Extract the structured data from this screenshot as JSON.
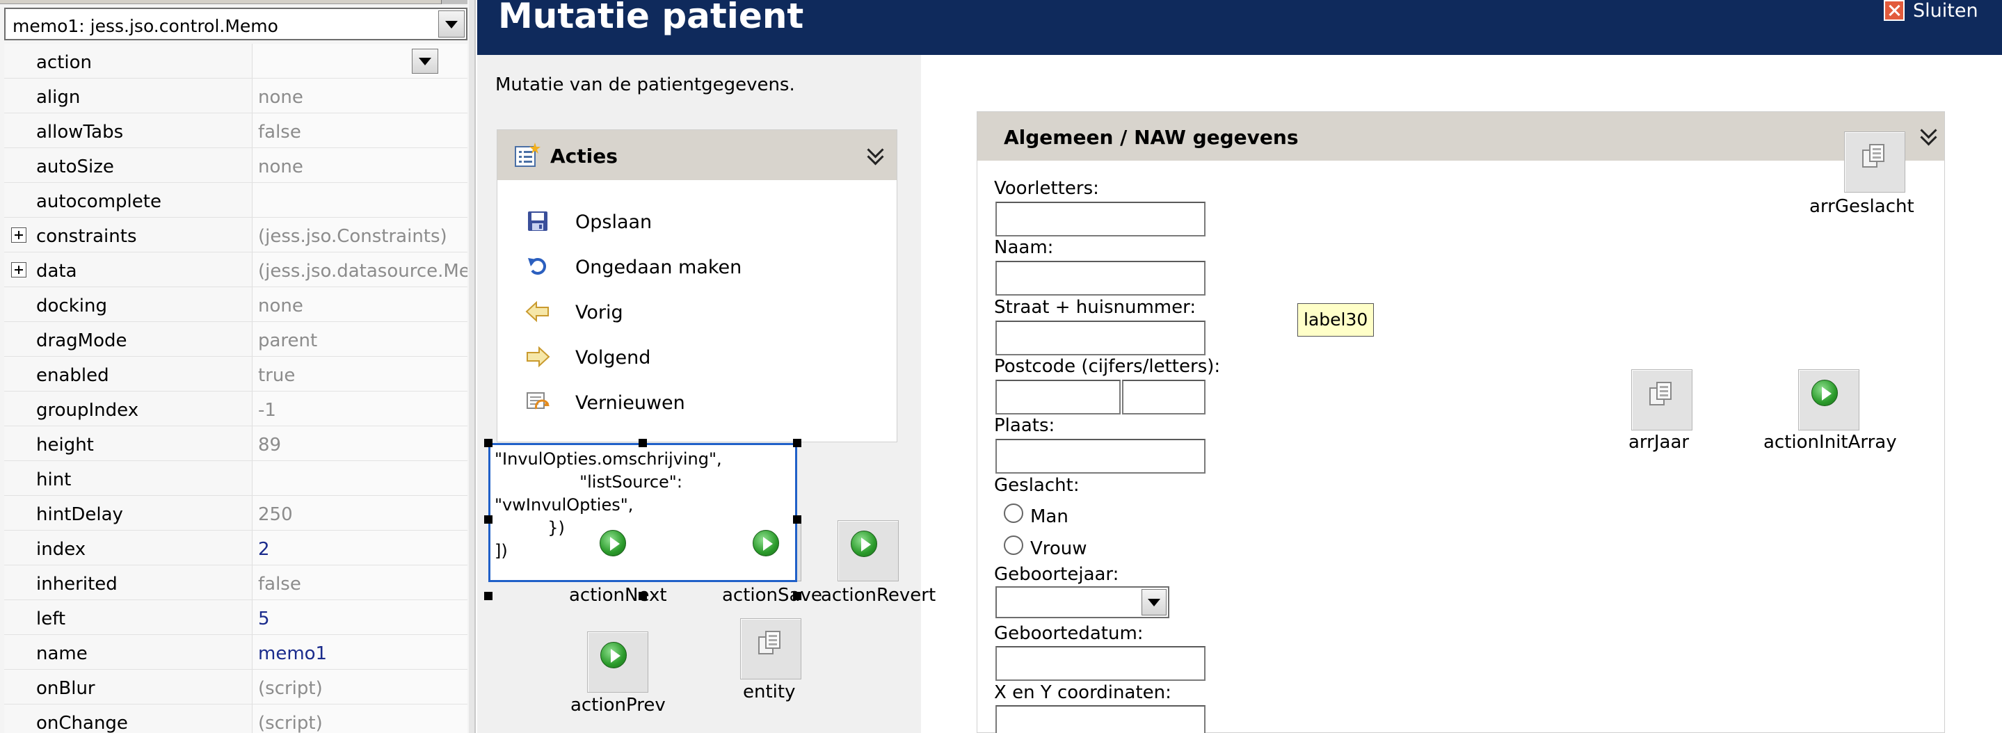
{
  "inspector": {
    "selected_component": "memo1: jess.jso.control.Memo",
    "properties": [
      {
        "name": "action",
        "value": "",
        "dropdown": true
      },
      {
        "name": "align",
        "value": "none"
      },
      {
        "name": "allowTabs",
        "value": "false"
      },
      {
        "name": "autoSize",
        "value": "none"
      },
      {
        "name": "autocomplete",
        "value": ""
      },
      {
        "name": "constraints",
        "value": "(jess.jso.Constraints)",
        "expandable": true
      },
      {
        "name": "data",
        "value": "(jess.jso.datasource.Memb",
        "expandable": true
      },
      {
        "name": "docking",
        "value": "none"
      },
      {
        "name": "dragMode",
        "value": "parent"
      },
      {
        "name": "enabled",
        "value": "true"
      },
      {
        "name": "groupIndex",
        "value": "-1"
      },
      {
        "name": "height",
        "value": "89"
      },
      {
        "name": "hint",
        "value": ""
      },
      {
        "name": "hintDelay",
        "value": "250"
      },
      {
        "name": "index",
        "value": "2",
        "modified": true
      },
      {
        "name": "inherited",
        "value": "false"
      },
      {
        "name": "left",
        "value": "5",
        "modified": true
      },
      {
        "name": "name",
        "value": "memo1",
        "modified": true
      },
      {
        "name": "onBlur",
        "value": "(script)"
      },
      {
        "name": "onChange",
        "value": "(script)"
      }
    ]
  },
  "header": {
    "title": "Mutatie patient",
    "close_label": "Sluiten"
  },
  "left_column": {
    "subtitle": "Mutatie van de patientgegevens.",
    "acties_panel": {
      "title": "Acties",
      "actions": [
        {
          "label": "Opslaan",
          "icon": "save-icon"
        },
        {
          "label": "Ongedaan maken",
          "icon": "undo-icon"
        },
        {
          "label": "Vorig",
          "icon": "arrow-left-icon"
        },
        {
          "label": "Volgend",
          "icon": "arrow-right-icon"
        },
        {
          "label": "Vernieuwen",
          "icon": "refresh-icon"
        }
      ]
    },
    "memo_text": "\"InvulOpties.omschrijving\",\n                \"listSource\":\n\"vwInvulOpties\",\n          })\n])",
    "components": [
      {
        "label": "actionNext",
        "kind": "action"
      },
      {
        "label": "actionSave",
        "kind": "action"
      },
      {
        "label": "actionRevert",
        "kind": "action"
      },
      {
        "label": "actionPrev",
        "kind": "action"
      },
      {
        "label": "entity",
        "kind": "array"
      }
    ]
  },
  "naw_panel": {
    "title": "Algemeen / NAW gegevens",
    "fields": {
      "voorletters": "Voorletters:",
      "naam": "Naam:",
      "straat": "Straat + huisnummer:",
      "postcode": "Postcode (cijfers/letters):",
      "plaats": "Plaats:",
      "geslacht": "Geslacht:",
      "geslacht_man": "Man",
      "geslacht_vrouw": "Vrouw",
      "geboortejaar": "Geboortejaar:",
      "geboortedatum": "Geboortedatum:",
      "coordinaten": "X en Y coordinaten:"
    },
    "label30": "label30",
    "components": [
      {
        "label": "arrGeslacht",
        "kind": "array"
      },
      {
        "label": "arrJaar",
        "kind": "array"
      },
      {
        "label": "actionInitArray",
        "kind": "action"
      }
    ]
  }
}
